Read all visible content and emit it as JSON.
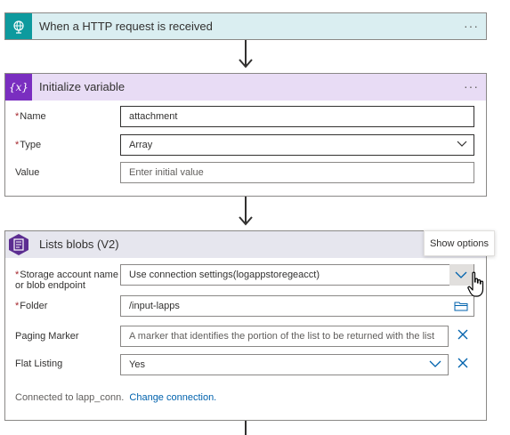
{
  "http_trigger": {
    "title": "When a HTTP request is received",
    "more": "···",
    "icon": "globe-icon",
    "color": "#0e9a9e"
  },
  "init_variable": {
    "title": "Initialize variable",
    "more": "···",
    "icon": "variable-icon",
    "icon_text": "{x}",
    "color": "#7a2ec0",
    "fields": {
      "name_label": "Name",
      "name_value": "attachment",
      "type_label": "Type",
      "type_value": "Array",
      "value_label": "Value",
      "value_placeholder": "Enter initial value"
    }
  },
  "list_blobs": {
    "title": "Lists blobs (V2)",
    "icon": "blob-storage-icon",
    "color": "#5c2d91",
    "fields": {
      "storage_label_line1": "Storage account name",
      "storage_label_line2": "or blob endpoint",
      "storage_value": "Use connection settings(logappstoregeacct)",
      "folder_label": "Folder",
      "folder_value": "/input-lapps",
      "paging_label": "Paging Marker",
      "paging_placeholder": "A marker that identifies the portion of the list to be returned with the list",
      "flat_label": "Flat Listing",
      "flat_value": "Yes"
    },
    "connected_to": "Connected to lapp_conn.",
    "change_connection": "Change connection."
  },
  "tooltip": {
    "text": "Show options"
  },
  "required_marker": "*"
}
